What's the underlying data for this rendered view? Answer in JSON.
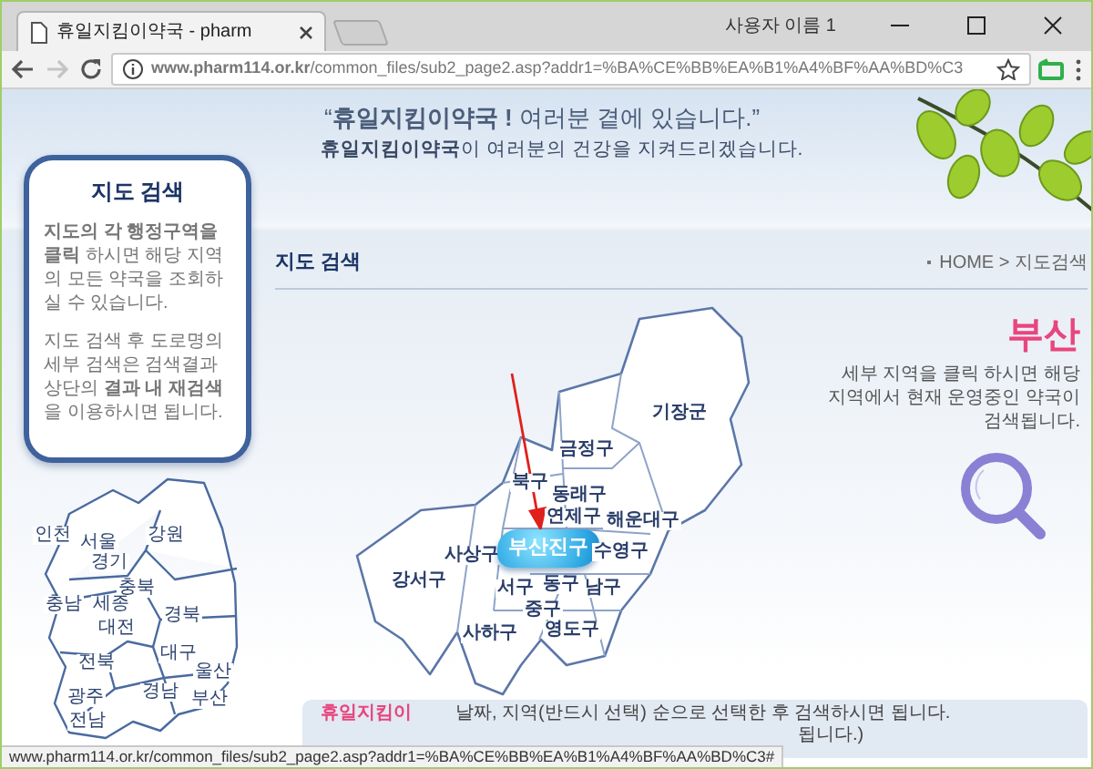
{
  "browser": {
    "tab_title": "휴일지킴이약국 - pharm",
    "user": "사용자 이름 1",
    "url": "**www.pharm114.or.kr**/common_files/sub2_page2.asp?addr1=%BA%CE%BB%EA%B1%A4%BF%AA%BD%C3",
    "forward_disabled": true
  },
  "header": {
    "slogan": "“**휴일지킴이약국 !** 여러분 곁에 있습니다.”",
    "subtitle": "**휴일지킴이약국**이 여러분의 건강을 지켜드리겠습니다."
  },
  "sidebar": {
    "title": "지도 검색",
    "paragraphs": [
      "**지도의 각 행정구역을 클릭** 하시면 해당 지역의 모든 약국을 조회하실 수 있습니다.",
      "지도 검색 후 도로명의 세부 검색은 검색결과 상단의 **결과 내 재검색**을 이용하시면 됩니다."
    ]
  },
  "korea_map": {
    "regions": [
      {
        "label": "인천"
      },
      {
        "label": "서울"
      },
      {
        "label": "강원"
      },
      {
        "label": "경기"
      },
      {
        "label": "충북"
      },
      {
        "label": "충남"
      },
      {
        "label": "세종"
      },
      {
        "label": "대전"
      },
      {
        "label": "경북"
      },
      {
        "label": "대구"
      },
      {
        "label": "전북"
      },
      {
        "label": "울산"
      },
      {
        "label": "광주"
      },
      {
        "label": "경남"
      },
      {
        "label": "부산"
      },
      {
        "label": "전남"
      }
    ]
  },
  "content": {
    "title": "지도 검색",
    "breadcrumb": "HOME > 지도검색"
  },
  "busan_map": {
    "districts": [
      {
        "label": "기장군",
        "selected": false
      },
      {
        "label": "금정구",
        "selected": false
      },
      {
        "label": "북구",
        "selected": false
      },
      {
        "label": "동래구",
        "selected": false
      },
      {
        "label": "연제구",
        "selected": false
      },
      {
        "label": "해운대구",
        "selected": false
      },
      {
        "label": "사상구",
        "selected": false
      },
      {
        "label": "부산진구",
        "selected": true
      },
      {
        "label": "수영구",
        "selected": false
      },
      {
        "label": "강서구",
        "selected": false
      },
      {
        "label": "서구",
        "selected": false
      },
      {
        "label": "동구",
        "selected": false
      },
      {
        "label": "남구",
        "selected": false
      },
      {
        "label": "중구",
        "selected": false
      },
      {
        "label": "사하구",
        "selected": false
      },
      {
        "label": "영도구",
        "selected": false
      }
    ]
  },
  "region": {
    "name": "부산",
    "description": "세부 지역을 클릭 하시면 해당지역에서 현재 운영중인 약국이 검색됩니다."
  },
  "notice": {
    "title": "휴일지킴이",
    "lines": [
      "날짜, 지역(반드시 선택) 순으로 선택한 후 검색하시면 됩니다.",
      "됩니다.)"
    ]
  },
  "status_bar": {
    "url": "www.pharm114.or.kr/common_files/sub2_page2.asp?addr1=%BA%CE%BB%EA%B1%A4%BF%AA%BD%C3#"
  }
}
